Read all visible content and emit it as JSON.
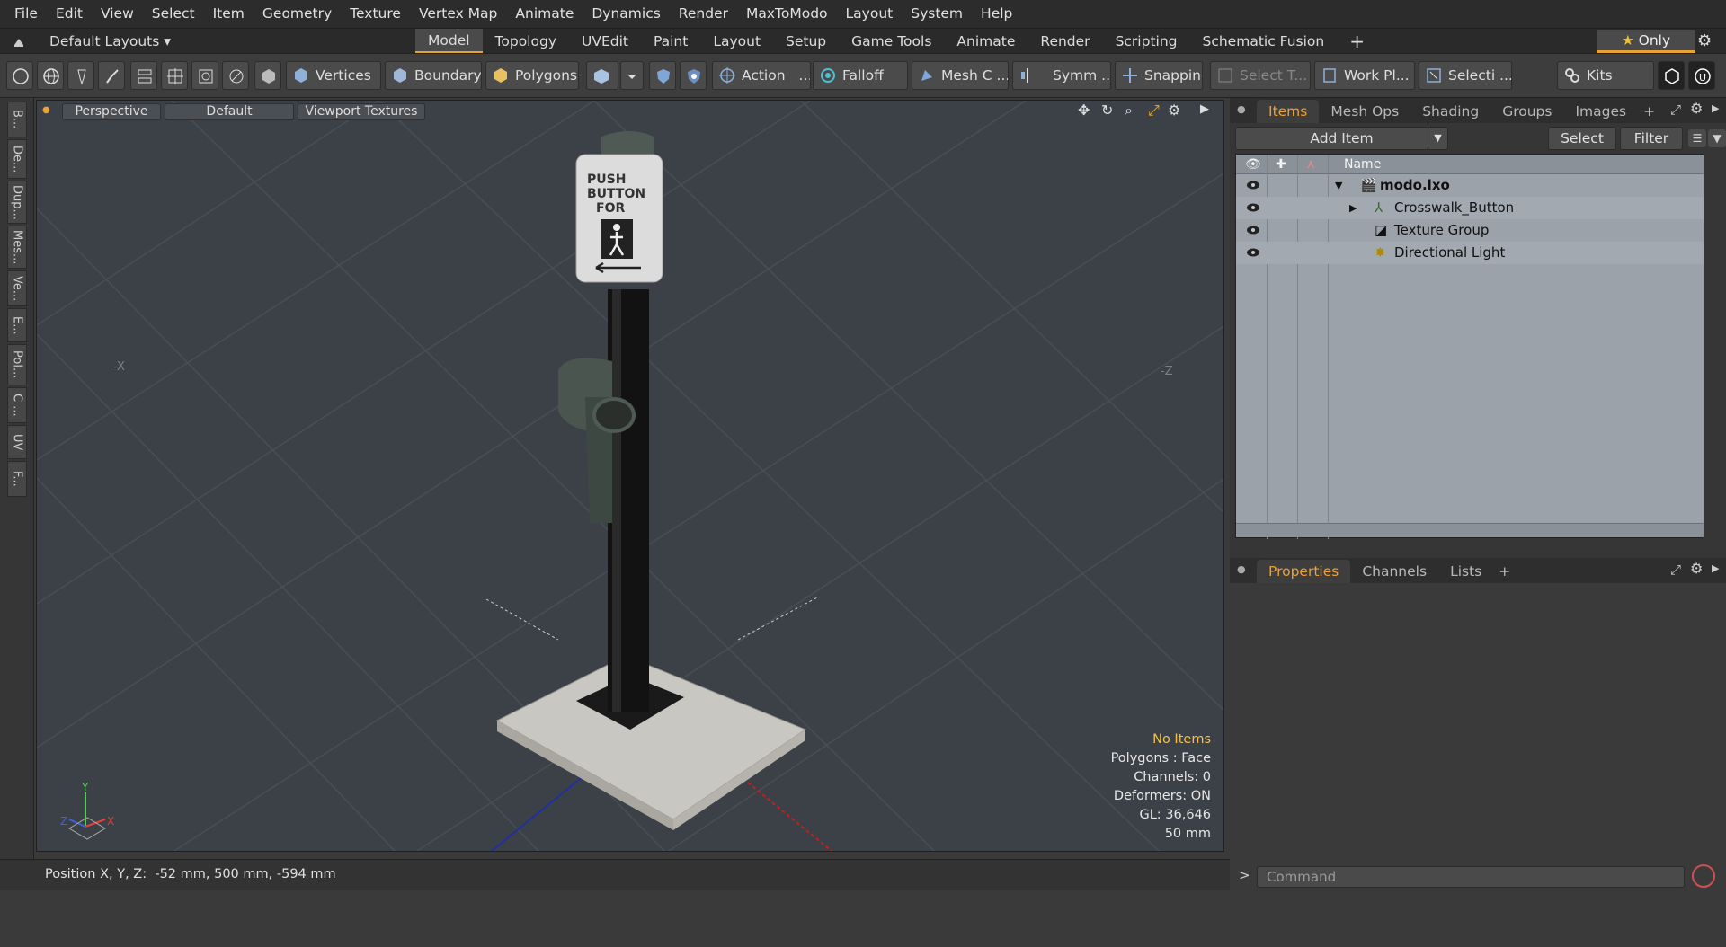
{
  "menu": [
    "File",
    "Edit",
    "View",
    "Select",
    "Item",
    "Geometry",
    "Texture",
    "Vertex Map",
    "Animate",
    "Dynamics",
    "Render",
    "MaxToModo",
    "Layout",
    "System",
    "Help"
  ],
  "layout_selector": "Default Layouts",
  "layout_tabs": [
    "Model",
    "Topology",
    "UVEdit",
    "Paint",
    "Layout",
    "Setup",
    "Game Tools",
    "Animate",
    "Render",
    "Scripting",
    "Schematic Fusion"
  ],
  "active_layout_tab": "Model",
  "only_label": "Only",
  "toolbar": {
    "vertices": "Vertices",
    "boundary": "Boundary",
    "polygons": "Polygons",
    "action": "Action",
    "falloff": "Falloff",
    "mesh": "Mesh C ...",
    "symm": "Symm ...",
    "snapping": "Snapping",
    "select_t": "Select T...",
    "workpl": "Work Pl...",
    "selecti": "Selecti ...",
    "kits": "Kits"
  },
  "left_tabs": [
    "B...",
    "De...",
    "Dup...",
    "Mes...",
    "Ve...",
    "E...",
    "Pol...",
    "C ...",
    "UV",
    "F..."
  ],
  "viewport": {
    "view": "Perspective",
    "style": "Default",
    "textures": "Viewport Textures",
    "axis_x_label": "-X",
    "axis_z_label": "-Z",
    "sign": {
      "line1": "PUSH",
      "line2": "BUTTON",
      "line3": "FOR"
    },
    "stats": {
      "selection": "No Items",
      "polygons": "Polygons : Face",
      "channels": "Channels: 0",
      "deformers": "Deformers: ON",
      "gl": "GL: 36,646",
      "scale": "50 mm"
    }
  },
  "status": {
    "position_label": "Position X, Y, Z:",
    "position_value": "-52 mm, 500 mm, -594 mm"
  },
  "items_panel": {
    "tabs": [
      "Items",
      "Mesh Ops",
      "Shading",
      "Groups",
      "Images"
    ],
    "active": "Items",
    "add_item": "Add Item",
    "select": "Select",
    "filter": "Filter",
    "column_name": "Name",
    "rows": [
      {
        "label": "modo.lxo",
        "indent": 0
      },
      {
        "label": "Crosswalk_Button",
        "indent": 1
      },
      {
        "label": "Texture Group",
        "indent": 1
      },
      {
        "label": "Directional Light",
        "indent": 1
      }
    ]
  },
  "props_panel": {
    "tabs": [
      "Properties",
      "Channels",
      "Lists"
    ],
    "active": "Properties"
  },
  "command_placeholder": "Command",
  "accent": "#e8a332"
}
